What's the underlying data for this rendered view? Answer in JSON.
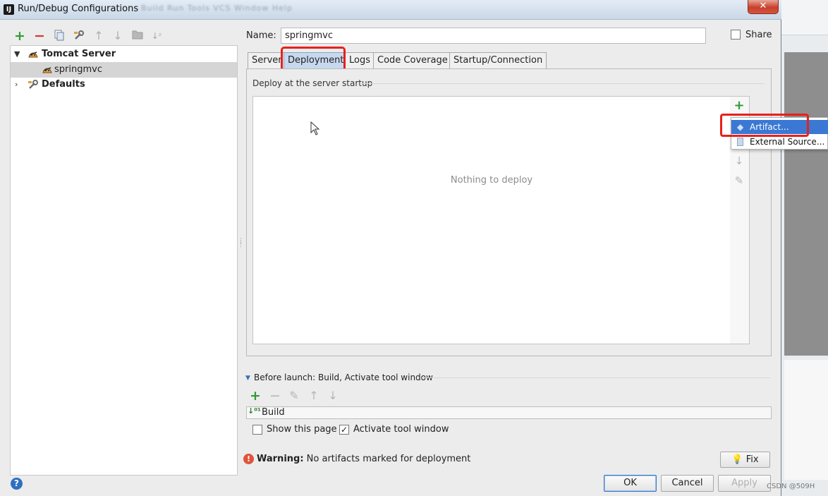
{
  "window": {
    "title": "Run/Debug Configurations",
    "blurred_menu": "Build  Run  Tools  VCS  Window  Help",
    "close_label": "✕"
  },
  "tree": {
    "items": [
      {
        "label": "Tomcat Server",
        "expanded": true
      },
      {
        "label": "springmvc",
        "selected": true
      },
      {
        "label": "Defaults",
        "expanded": false
      }
    ]
  },
  "form": {
    "name_label": "Name:",
    "name_value": "springmvc",
    "share_label": "Share",
    "share_checked": false
  },
  "tabs": [
    {
      "label": "Server"
    },
    {
      "label": "Deployment",
      "active": true
    },
    {
      "label": "Logs"
    },
    {
      "label": "Code Coverage"
    },
    {
      "label": "Startup/Connection"
    }
  ],
  "deployment": {
    "section_title": "Deploy at the server startup",
    "empty_text": "Nothing to deploy"
  },
  "popup_menu": {
    "items": [
      {
        "label": "Artifact...",
        "highlighted": true
      },
      {
        "label": "External Source..."
      }
    ]
  },
  "before_launch": {
    "title": "Before launch: Build, Activate tool window",
    "tasks": [
      {
        "label": "Build"
      }
    ],
    "show_this_page_label": "Show this page",
    "show_this_page_checked": false,
    "activate_tool_window_label": "Activate tool window",
    "activate_tool_window_checked": true
  },
  "warning": {
    "bold_text": "Warning:",
    "message": "No artifacts marked for deployment",
    "fix_label": "Fix"
  },
  "buttons": {
    "ok": "OK",
    "cancel": "Cancel",
    "apply": "Apply",
    "help": "?"
  },
  "watermark": "CSDN @509H",
  "colors": {
    "highlight_red": "#e8201b",
    "selection_blue": "#3a78d4",
    "add_green": "#2e9b35",
    "remove_red": "#d33a2c"
  }
}
